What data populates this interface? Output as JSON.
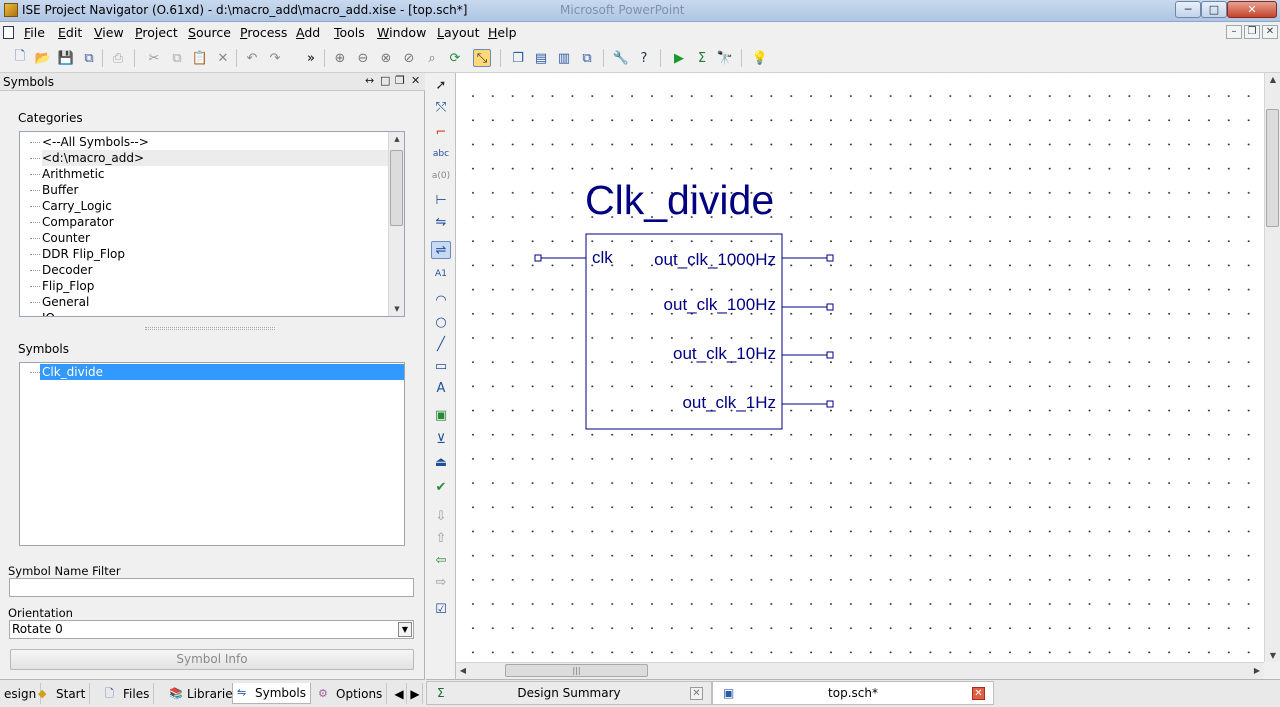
{
  "window": {
    "title": "ISE Project Navigator (O.61xd) - d:\\macro_add\\macro_add.xise - [top.sch*]",
    "background_app": "Microsoft PowerPoint",
    "controls": {
      "minimize": "─",
      "maximize": "□",
      "close": "✕"
    }
  },
  "menu": {
    "items": [
      "File",
      "Edit",
      "View",
      "Project",
      "Source",
      "Process",
      "Add",
      "Tools",
      "Window",
      "Layout",
      "Help"
    ],
    "mnemonics": [
      "F",
      "E",
      "V",
      "P",
      "S",
      "P",
      "A",
      "T",
      "W",
      "L",
      "H"
    ],
    "mdi_controls": [
      "–",
      "❐",
      "✕"
    ]
  },
  "toolbar": {
    "icons": [
      "new-file-icon",
      "open-folder-icon",
      "save-icon",
      "save-all-icon",
      "print-icon",
      "cut-icon",
      "copy-icon",
      "paste-icon",
      "delete-icon",
      "undo-icon",
      "redo-icon",
      "more-icon",
      "zoom-in-icon",
      "zoom-out-icon",
      "zoom-full-icon",
      "zoom-selected-icon",
      "zoom-fit-icon",
      "refresh-icon",
      "select-mode-icon",
      "cascade-icon",
      "tile-horizontal-icon",
      "tile-vertical-icon",
      "window-switch-icon",
      "wrench-icon",
      "help-pointer-icon",
      "run-icon",
      "sigma-icon",
      "telescope-icon",
      "lightbulb-icon"
    ],
    "overflow": "»"
  },
  "left_panel": {
    "title": "Symbols",
    "header_controls": [
      "↔",
      "□",
      "❐",
      "✕"
    ],
    "categories_label": "Categories",
    "categories": [
      "<--All Symbols-->",
      "<d:\\macro_add>",
      "Arithmetic",
      "Buffer",
      "Carry_Logic",
      "Comparator",
      "Counter",
      "DDR Flip_Flop",
      "Decoder",
      "Flip_Flop",
      "General",
      "IO"
    ],
    "selected_category": 1,
    "symbols_label": "Symbols",
    "symbols": [
      "Clk_divide"
    ],
    "symbol_name_filter_label": "Symbol Name Filter",
    "symbol_name_filter_value": "",
    "orientation_label": "Orientation",
    "orientation_value": "Rotate 0",
    "symbol_info_button": "Symbol Info"
  },
  "left_tabs": {
    "items": [
      "esign",
      "Start",
      "Files",
      "Libraries",
      "Symbols",
      "Options"
    ],
    "active": "Symbols",
    "scroll_left": "◀",
    "scroll_right": "▶"
  },
  "schematic": {
    "symbol_name": "Clk_divide",
    "input_pins": [
      "clk"
    ],
    "output_pins": [
      "out_clk_1000Hz",
      "out_clk_100Hz",
      "out_clk_10Hz",
      "out_clk_1Hz"
    ],
    "line_color": "#000080",
    "scroll_grip": "|||"
  },
  "document_tabs": {
    "items": [
      "Design Summary",
      "top.sch*"
    ],
    "active": "top.sch*",
    "close_glyph": "✕"
  }
}
